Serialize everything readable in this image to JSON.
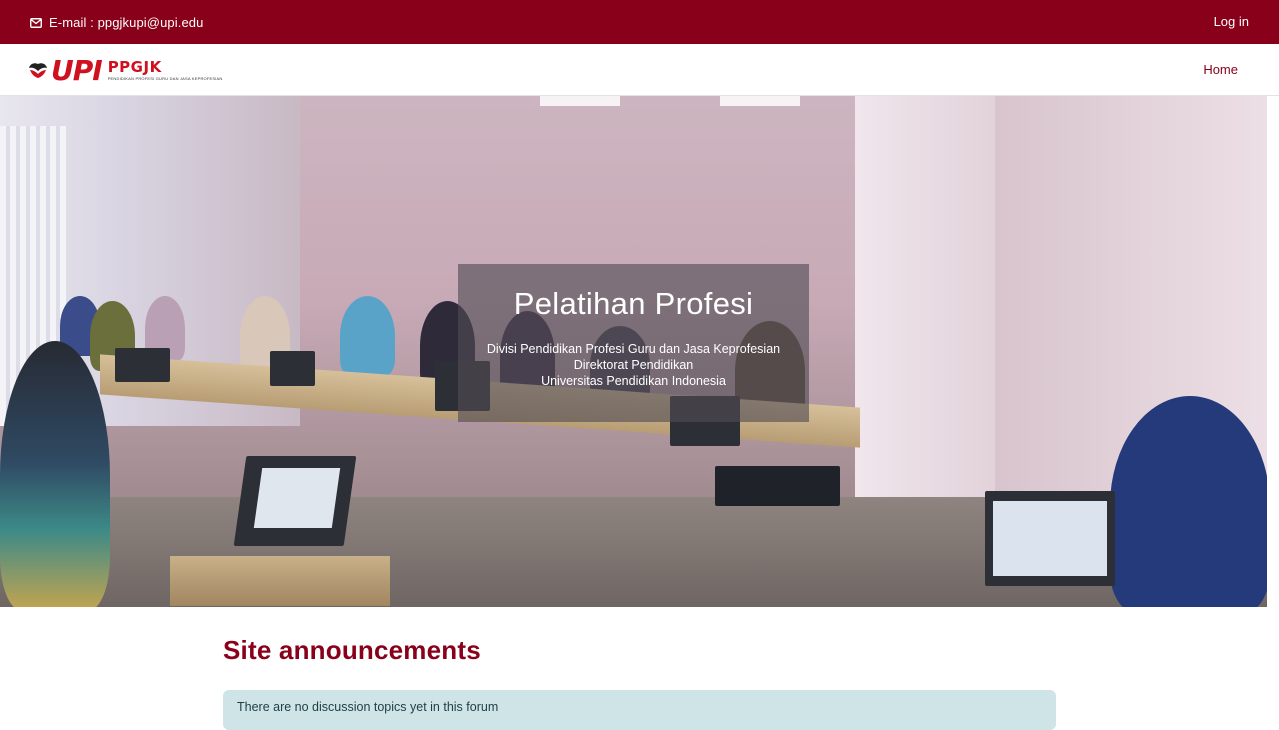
{
  "topbar": {
    "email_label": "E-mail : ppgjkupi@upi.edu",
    "login_label": "Log in",
    "background_color": "#880019",
    "email_icon": "envelope-icon"
  },
  "navbar": {
    "logo": {
      "upi_text": "UPI",
      "ppgjk_text": "PPGJK",
      "ppgjk_subtitle": "PENDIDIKAN PROFESI GURU DAN JASA KEPROFESIAN"
    },
    "home_label": "Home",
    "accent_color": "#880019"
  },
  "hero": {
    "title": "Pelatihan Profesi",
    "subtitle_lines": [
      "Divisi Pendidikan Profesi Guru dan Jasa Keprofesian",
      "Direktorat Pendidikan",
      "Universitas Pendidikan Indonesia"
    ]
  },
  "main": {
    "section_title": "Site announcements",
    "alert_text": "There are no discussion topics yet in this forum"
  }
}
